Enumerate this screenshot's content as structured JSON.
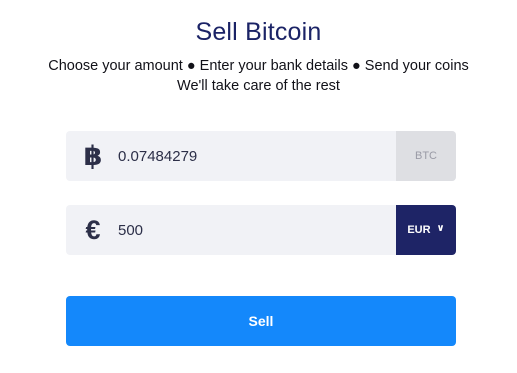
{
  "header": {
    "title": "Sell Bitcoin",
    "subtitle_line1": "Choose your amount ● Enter your bank details ● Send your coins",
    "subtitle_line2": "We'll take care of the rest"
  },
  "crypto_field": {
    "icon": "bitcoin-icon",
    "icon_glyph": "฿",
    "value": "0.07484279",
    "unit": "BTC"
  },
  "fiat_field": {
    "icon": "euro-icon",
    "icon_glyph": "€",
    "value": "500",
    "currency": "EUR",
    "dropdown_icon": "chevron-down-icon",
    "dropdown_glyph": "∨"
  },
  "actions": {
    "sell_label": "Sell"
  },
  "colors": {
    "brand_navy": "#1e2466",
    "primary_blue": "#1488fb",
    "field_bg": "#f1f2f6"
  }
}
